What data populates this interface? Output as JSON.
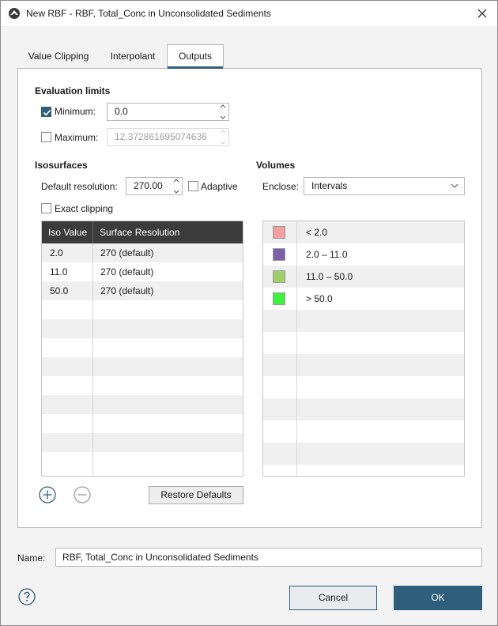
{
  "window": {
    "title": "New RBF - RBF, Total_Conc in Unconsolidated Sediments"
  },
  "tabs": [
    {
      "label": "Value Clipping"
    },
    {
      "label": "Interpolant"
    },
    {
      "label": "Outputs"
    }
  ],
  "evaluation_limits": {
    "title": "Evaluation limits",
    "minimum": {
      "label": "Minimum:",
      "checked": true,
      "value": "0.0"
    },
    "maximum": {
      "label": "Maximum:",
      "checked": false,
      "value": "12.372861695074636"
    }
  },
  "isosurfaces": {
    "title": "Isosurfaces",
    "default_resolution_label": "Default resolution:",
    "default_resolution_value": "270.00",
    "adaptive_label": "Adaptive",
    "adaptive_checked": false,
    "exact_clipping_label": "Exact clipping",
    "exact_clipping_checked": false,
    "columns": [
      "Iso Value",
      "Surface Resolution"
    ],
    "rows": [
      {
        "iso": "2.0",
        "res": "270 (default)"
      },
      {
        "iso": "11.0",
        "res": "270 (default)"
      },
      {
        "iso": "50.0",
        "res": "270 (default)"
      }
    ],
    "restore_label": "Restore Defaults"
  },
  "volumes": {
    "title": "Volumes",
    "enclose_label": "Enclose:",
    "enclose_value": "Intervals",
    "rows": [
      {
        "label": "< 2.0",
        "color": "#f4a0a0"
      },
      {
        "label": "2.0 – 11.0",
        "color": "#7b62a8"
      },
      {
        "label": "11.0 – 50.0",
        "color": "#9fcf6a"
      },
      {
        "label": "> 50.0",
        "color": "#3ef03e"
      }
    ]
  },
  "name": {
    "label": "Name:",
    "value": "RBF, Total_Conc in Unconsolidated Sediments"
  },
  "buttons": {
    "cancel": "Cancel",
    "ok": "OK"
  },
  "colors": {
    "accent": "#2f5d7c",
    "header_dark": "#3b3b3b"
  }
}
